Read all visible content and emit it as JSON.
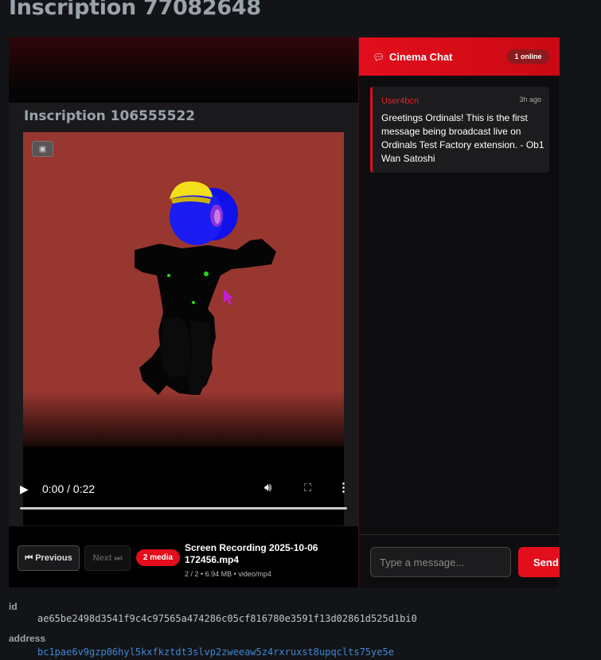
{
  "page": {
    "title": "Inscription 77082648"
  },
  "player": {
    "frame_title": "Inscription 106555522",
    "video": {
      "time": "0:00 / 0:22",
      "progress": 0
    },
    "nav": {
      "prev_label": "Previous",
      "next_label": "Next",
      "media_count": "2 media",
      "file_name": "Screen Recording 2025-10-06 172456.mp4",
      "file_meta": "2 / 2 • 6.94 MB • video/mp4"
    }
  },
  "chat": {
    "title": "Cinema Chat",
    "online": "1 online",
    "messages": [
      {
        "user": "User4bcn",
        "time": "3h ago",
        "text": "Greetings Ordinals! This is the first message being broadcast live on Ordinals Test Factory extension. - Ob1 Wan Satoshi"
      }
    ],
    "input_placeholder": "Type a message...",
    "send_label": "Send"
  },
  "details": {
    "id_label": "id",
    "id_value": "ae65be2498d3541f9c4c97565a474286c05cf816780e3591f13d02861d525d1bi0",
    "address_label": "address",
    "address_value": "bc1pae6v9gzp06hyl5kxfkztdt3slvp2zweeaw5z4rxruxst8upqclts75ye5e"
  },
  "colors": {
    "accent": "#e30e1c",
    "background": "#131417",
    "link": "#3e87d6"
  }
}
